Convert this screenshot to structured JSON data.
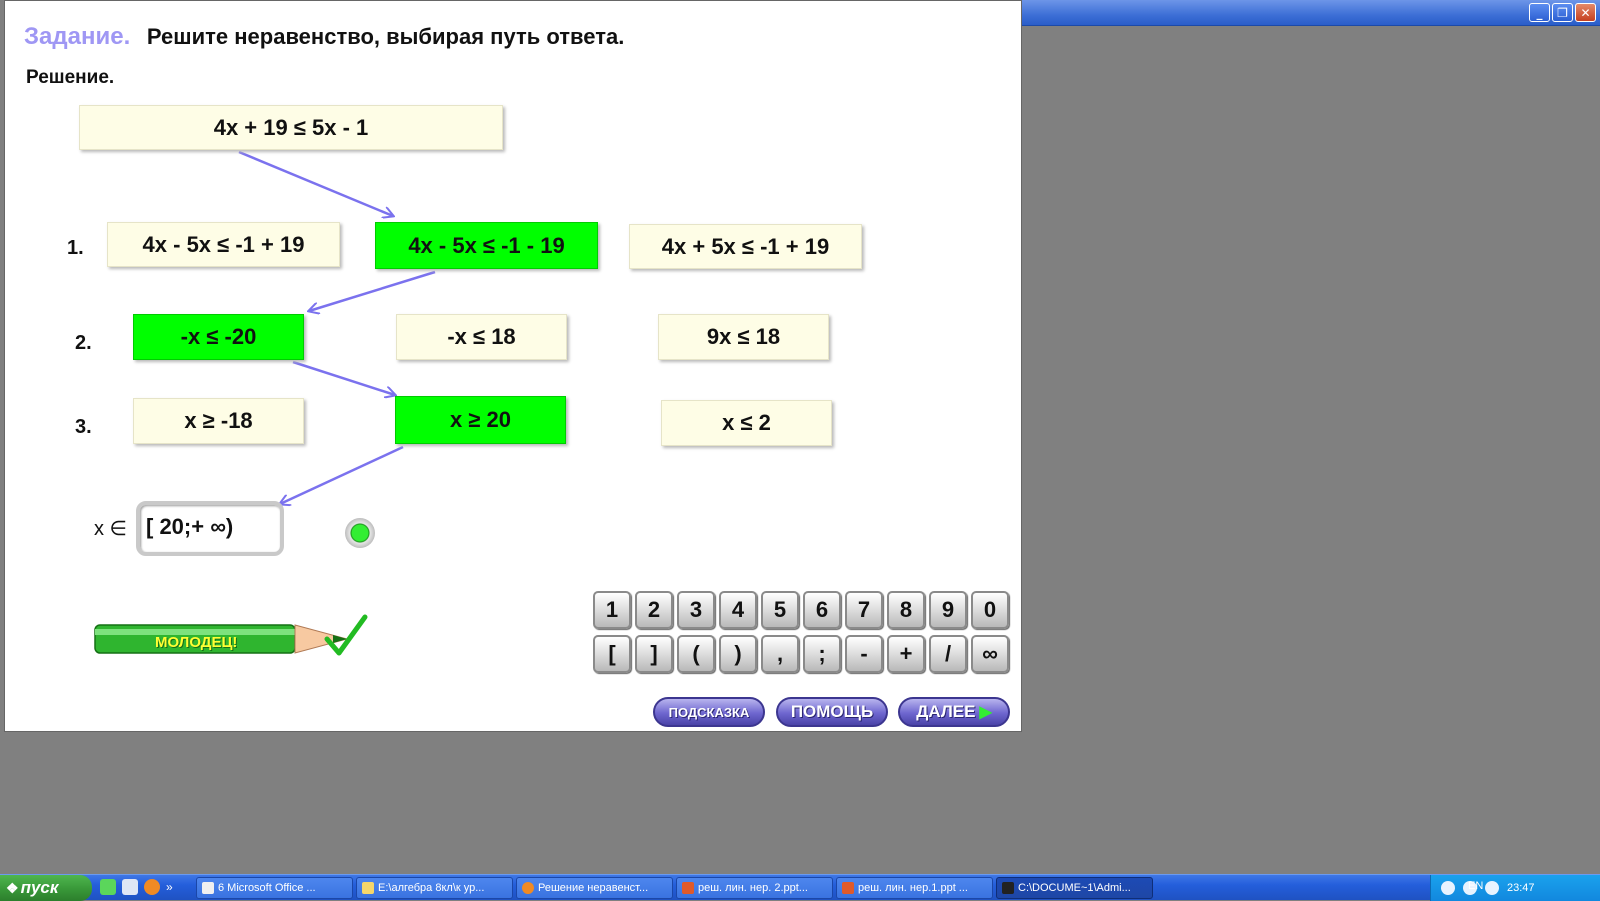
{
  "window": {
    "controls": [
      {
        "name": "minimize",
        "glyph": "_"
      },
      {
        "name": "restore",
        "glyph": "❐"
      },
      {
        "name": "close",
        "glyph": "✕"
      }
    ]
  },
  "slide": {
    "task_label": "Задание.",
    "task_text": "Решите неравенство, выбирая путь ответа.",
    "solution_label": "Решение.",
    "original_inequality": "4x + 19 ≤ 5x - 1",
    "steps": [
      {
        "number": "1.",
        "options": [
          {
            "text": "4x - 5x ≤ -1 + 19",
            "selected": false
          },
          {
            "text": "4x - 5x ≤ -1 - 19",
            "selected": true
          },
          {
            "text": "4x + 5x ≤ -1 + 19",
            "selected": false
          }
        ]
      },
      {
        "number": "2.",
        "options": [
          {
            "text": "-x ≤ -20",
            "selected": true
          },
          {
            "text": "-x ≤ 18",
            "selected": false
          },
          {
            "text": "9x ≤ 18",
            "selected": false
          }
        ]
      },
      {
        "number": "3.",
        "options": [
          {
            "text": "x ≥ -18",
            "selected": false
          },
          {
            "text": "x ≥ 20",
            "selected": true
          },
          {
            "text": "x ≤ 2",
            "selected": false
          }
        ]
      }
    ],
    "answer_prefix": "x ∈",
    "answer_value": "[ 20;+ ∞)",
    "praise": "МОЛОДЕЦ!",
    "keypad_row1": [
      "1",
      "2",
      "3",
      "4",
      "5",
      "6",
      "7",
      "8",
      "9",
      "0"
    ],
    "keypad_row2": [
      "[",
      "]",
      "(",
      ")",
      ",",
      ";",
      "-",
      "+",
      "/",
      "∞"
    ],
    "buttons": {
      "hint": "ПОДСКАЗКА",
      "help": "ПОМОЩЬ",
      "next": "ДАЛЕЕ"
    },
    "colors": {
      "selected": "#00ff00",
      "option": "#fefde6",
      "arrow": "#7b72ee",
      "task_label": "#9f97f4"
    }
  },
  "taskbar": {
    "start": "пуск",
    "quick_more": "»",
    "tasks": [
      {
        "label": "6 Microsoft Office ...",
        "active": false
      },
      {
        "label": "E:\\алгебра 8кл\\к ур...",
        "active": false
      },
      {
        "label": "Решение неравенст...",
        "active": false
      },
      {
        "label": "реш. лин. нер. 2.ppt...",
        "active": false
      },
      {
        "label": "реш. лин. нер.1.ppt ...",
        "active": false
      },
      {
        "label": "C:\\DOCUME~1\\Admi...",
        "active": true
      }
    ],
    "language": "EN",
    "clock": "23:47"
  }
}
